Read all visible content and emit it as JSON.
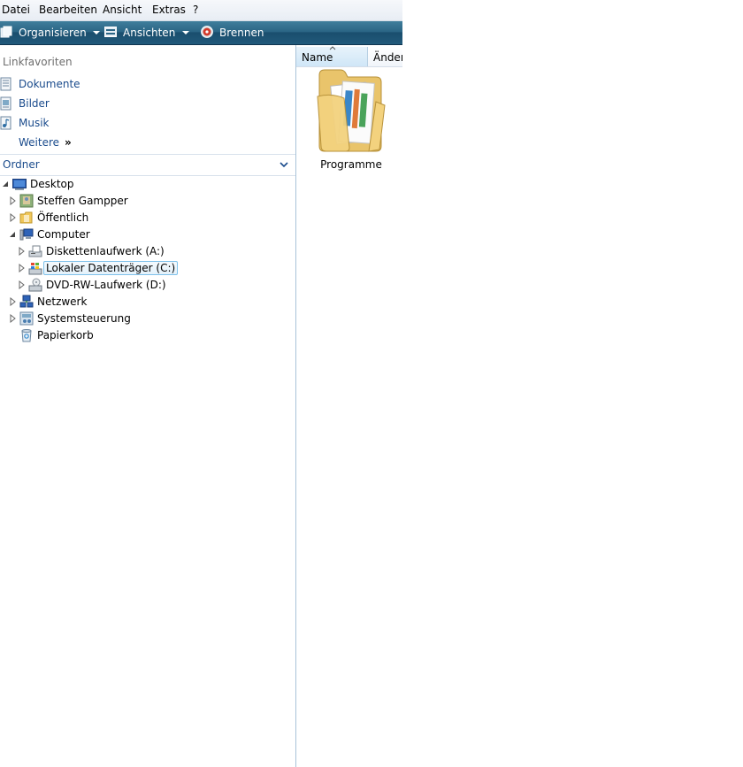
{
  "menubar": {
    "items": [
      "Datei",
      "Bearbeiten",
      "Ansicht",
      "Extras",
      "?"
    ]
  },
  "commandbar": {
    "organize": "Organisieren",
    "views": "Ansichten",
    "burn": "Brennen"
  },
  "favorites": {
    "title": "Linkfavoriten",
    "items": [
      "Dokumente",
      "Bilder",
      "Musik"
    ],
    "more": "Weitere",
    "more_glyph": "»"
  },
  "folders": {
    "title": "Ordner",
    "tree": {
      "desktop": "Desktop",
      "user": "Steffen Gampper",
      "public": "Öffentlich",
      "computer": "Computer",
      "floppy": "Diskettenlaufwerk (A:)",
      "local_disk": "Lokaler Datenträger (C:)",
      "dvd": "DVD-RW-Laufwerk (D:)",
      "network": "Netzwerk",
      "control_panel": "Systemsteuerung",
      "recycle_bin": "Papierkorb"
    }
  },
  "content": {
    "columns": {
      "name": "Name",
      "changed": "Änder"
    },
    "items": [
      {
        "label": "Programme",
        "icon": "folder-icon"
      }
    ]
  },
  "colors": {
    "link": "#1a4b8c",
    "commandbar": "#21597a",
    "selection_border": "#7fc1ea"
  }
}
